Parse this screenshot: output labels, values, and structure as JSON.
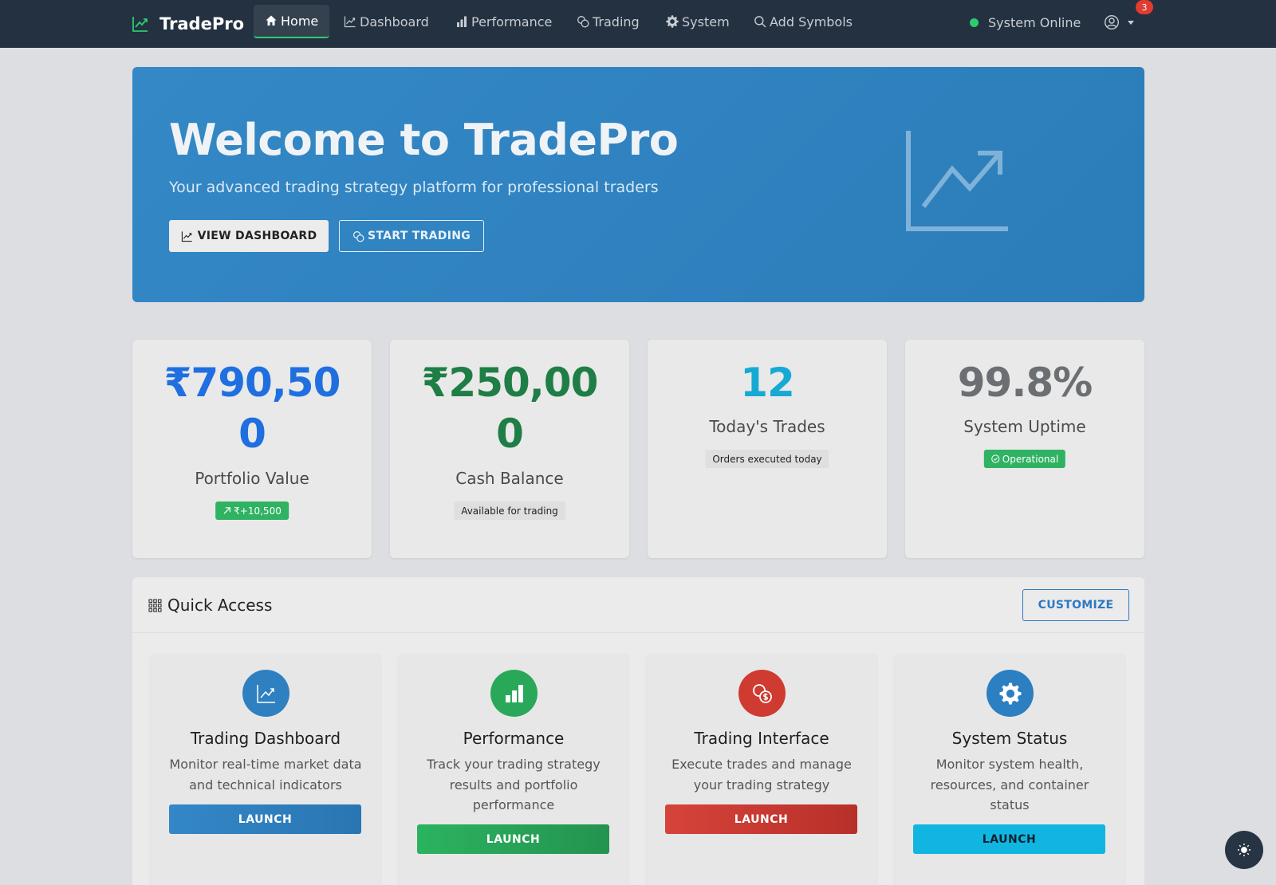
{
  "nav": {
    "brand": "TradePro",
    "items": [
      {
        "label": "Home",
        "icon": "house-icon"
      },
      {
        "label": "Dashboard",
        "icon": "graph-up-icon"
      },
      {
        "label": "Performance",
        "icon": "bar-chart-icon"
      },
      {
        "label": "Trading",
        "icon": "coins-icon"
      },
      {
        "label": "System",
        "icon": "gear-icon"
      },
      {
        "label": "Add Symbols",
        "icon": "search-icon"
      }
    ],
    "status": "System Online",
    "notification_count": "3"
  },
  "hero": {
    "title": "Welcome to TradePro",
    "subtitle": "Your advanced trading strategy platform for professional traders",
    "primary_button": "VIEW DASHBOARD",
    "secondary_button": "START TRADING"
  },
  "stats": [
    {
      "value": "₹790,500",
      "label": "Portfolio Value",
      "badge": "₹+10,500",
      "color": "#1f6fe0"
    },
    {
      "value": "₹250,000",
      "label": "Cash Balance",
      "badge": "Available for trading",
      "color": "#1e7e45"
    },
    {
      "value": "12",
      "label": "Today's Trades",
      "badge": "Orders executed today",
      "color": "#16a9d4"
    },
    {
      "value": "99.8%",
      "label": "System Uptime",
      "badge": "Operational",
      "color": "#6b6f73"
    }
  ],
  "quick_access": {
    "title": "Quick Access",
    "customize": "CUSTOMIZE",
    "cards": [
      {
        "title": "Trading Dashboard",
        "desc": "Monitor real-time market data and technical indicators",
        "button": "LAUNCH",
        "color": "#2f80c1"
      },
      {
        "title": "Performance",
        "desc": "Track your trading strategy results and portfolio performance",
        "button": "LAUNCH",
        "color": "#29a85a"
      },
      {
        "title": "Trading Interface",
        "desc": "Execute trades and manage your trading strategy",
        "button": "LAUNCH",
        "color": "#cf3b30"
      },
      {
        "title": "System Status",
        "desc": "Monitor system health, resources, and container status",
        "button": "LAUNCH",
        "color": "#10b6e0"
      }
    ]
  },
  "colors": {
    "navbar": "#243140",
    "hero": "#3086c4",
    "online": "#2ecc71",
    "badge_red": "#e03c31"
  }
}
